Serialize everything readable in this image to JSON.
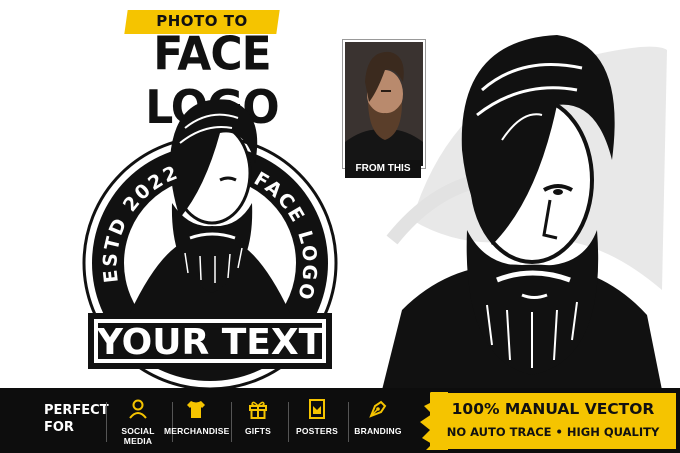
{
  "header": {
    "badge": "PHOTO TO",
    "title": "FACE LOGO"
  },
  "thumbnail": {
    "caption": "FROM THIS"
  },
  "logo": {
    "arc_left": "ESTD 2022",
    "arc_right": "FACE LOGO",
    "banner": "YOUR TEXT"
  },
  "footer": {
    "perfect_line1": "PERFECT",
    "perfect_line2": "FOR",
    "features": [
      {
        "label": "SOCIAL MEDIA",
        "icon": "person-icon"
      },
      {
        "label": "MERCHANDISE",
        "icon": "tshirt-icon"
      },
      {
        "label": "GIFTS",
        "icon": "gift-icon"
      },
      {
        "label": "POSTERS",
        "icon": "poster-icon"
      },
      {
        "label": "BRANDING",
        "icon": "pen-nib-icon"
      }
    ],
    "promo_line1": "100% MANUAL VECTOR",
    "promo_line2": "NO AUTO TRACE • HIGH QUALITY"
  },
  "colors": {
    "accent": "#f5c400",
    "dark": "#0d0d0d",
    "icon": "#f5c400"
  }
}
